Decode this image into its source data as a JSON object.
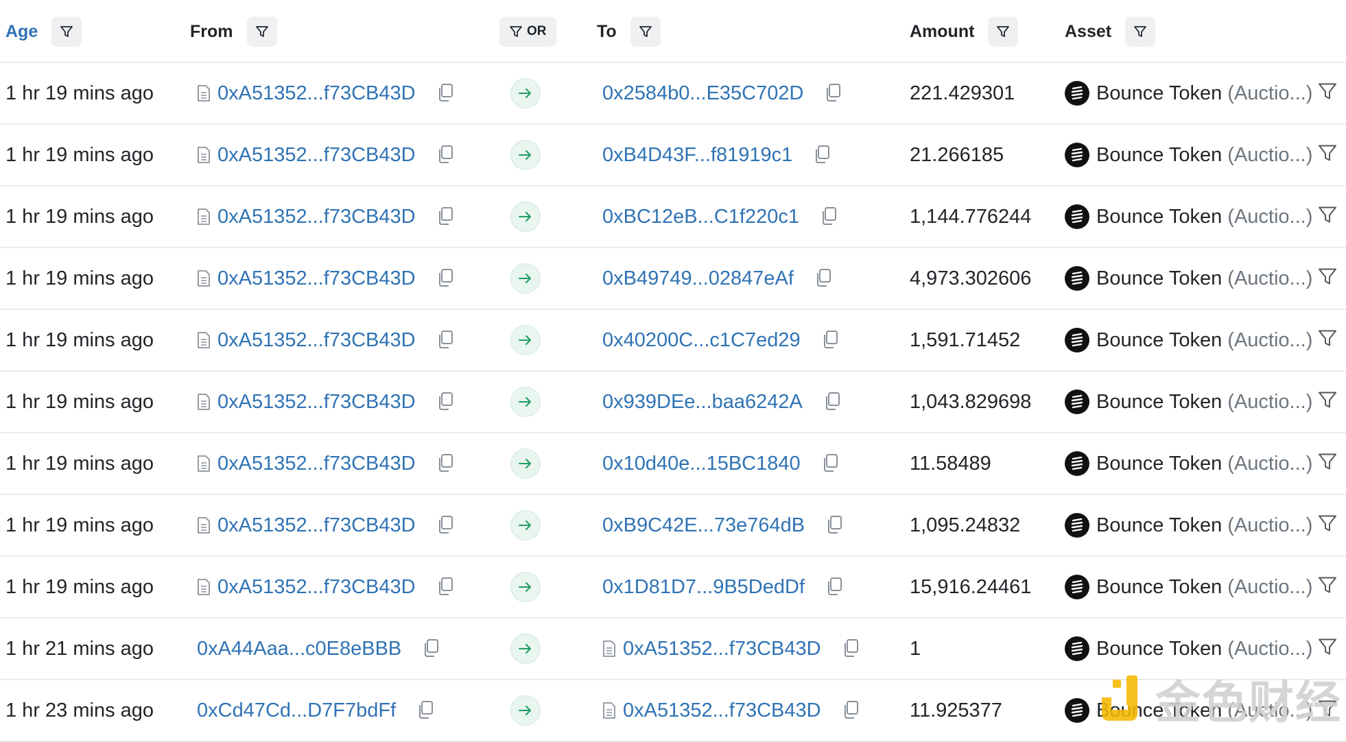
{
  "headers": {
    "age": "Age",
    "from": "From",
    "or": "OR",
    "to": "To",
    "amount": "Amount",
    "asset": "Asset"
  },
  "rows": [
    {
      "age": "1 hr 19 mins ago",
      "from": "0xA51352...f73CB43D",
      "from_contract": true,
      "to": "0x2584b0...E35C702D",
      "to_contract": false,
      "amount": "221.429301",
      "asset_name": "Bounce Token",
      "asset_symbol": "(Auctio...)"
    },
    {
      "age": "1 hr 19 mins ago",
      "from": "0xA51352...f73CB43D",
      "from_contract": true,
      "to": "0xB4D43F...f81919c1",
      "to_contract": false,
      "amount": "21.266185",
      "asset_name": "Bounce Token",
      "asset_symbol": "(Auctio...)"
    },
    {
      "age": "1 hr 19 mins ago",
      "from": "0xA51352...f73CB43D",
      "from_contract": true,
      "to": "0xBC12eB...C1f220c1",
      "to_contract": false,
      "amount": "1,144.776244",
      "asset_name": "Bounce Token",
      "asset_symbol": "(Auctio...)"
    },
    {
      "age": "1 hr 19 mins ago",
      "from": "0xA51352...f73CB43D",
      "from_contract": true,
      "to": "0xB49749...02847eAf",
      "to_contract": false,
      "amount": "4,973.302606",
      "asset_name": "Bounce Token",
      "asset_symbol": "(Auctio...)"
    },
    {
      "age": "1 hr 19 mins ago",
      "from": "0xA51352...f73CB43D",
      "from_contract": true,
      "to": "0x40200C...c1C7ed29",
      "to_contract": false,
      "amount": "1,591.71452",
      "asset_name": "Bounce Token",
      "asset_symbol": "(Auctio...)"
    },
    {
      "age": "1 hr 19 mins ago",
      "from": "0xA51352...f73CB43D",
      "from_contract": true,
      "to": "0x939DEe...baa6242A",
      "to_contract": false,
      "amount": "1,043.829698",
      "asset_name": "Bounce Token",
      "asset_symbol": "(Auctio...)"
    },
    {
      "age": "1 hr 19 mins ago",
      "from": "0xA51352...f73CB43D",
      "from_contract": true,
      "to": "0x10d40e...15BC1840",
      "to_contract": false,
      "amount": "11.58489",
      "asset_name": "Bounce Token",
      "asset_symbol": "(Auctio...)"
    },
    {
      "age": "1 hr 19 mins ago",
      "from": "0xA51352...f73CB43D",
      "from_contract": true,
      "to": "0xB9C42E...73e764dB",
      "to_contract": false,
      "amount": "1,095.24832",
      "asset_name": "Bounce Token",
      "asset_symbol": "(Auctio...)"
    },
    {
      "age": "1 hr 19 mins ago",
      "from": "0xA51352...f73CB43D",
      "from_contract": true,
      "to": "0x1D81D7...9B5DedDf",
      "to_contract": false,
      "amount": "15,916.24461",
      "asset_name": "Bounce Token",
      "asset_symbol": "(Auctio...)"
    },
    {
      "age": "1 hr 21 mins ago",
      "from": "0xA44Aaa...c0E8eBBB",
      "from_contract": false,
      "to": "0xA51352...f73CB43D",
      "to_contract": true,
      "amount": "1",
      "asset_name": "Bounce Token",
      "asset_symbol": "(Auctio...)"
    },
    {
      "age": "1 hr 23 mins ago",
      "from": "0xCd47Cd...D7F7bdFf",
      "from_contract": false,
      "to": "0xA51352...f73CB43D",
      "to_contract": true,
      "amount": "11.925377",
      "asset_name": "Bounce Token",
      "asset_symbol": "(Auctio...)"
    }
  ],
  "watermark": {
    "text": "金色财经"
  },
  "colors": {
    "link": "#2f73b5",
    "border": "#e9ecef",
    "filter_bg": "#eef0f2",
    "arrow_bg": "#e9f5ef",
    "arrow_fg": "#1f9d62",
    "watermark_logo": "#f5b800"
  },
  "icons": {
    "filter": "funnel-icon",
    "copy": "copy-icon",
    "contract": "document-icon",
    "direction": "arrow-right-icon",
    "token": "bounce-token-icon"
  }
}
